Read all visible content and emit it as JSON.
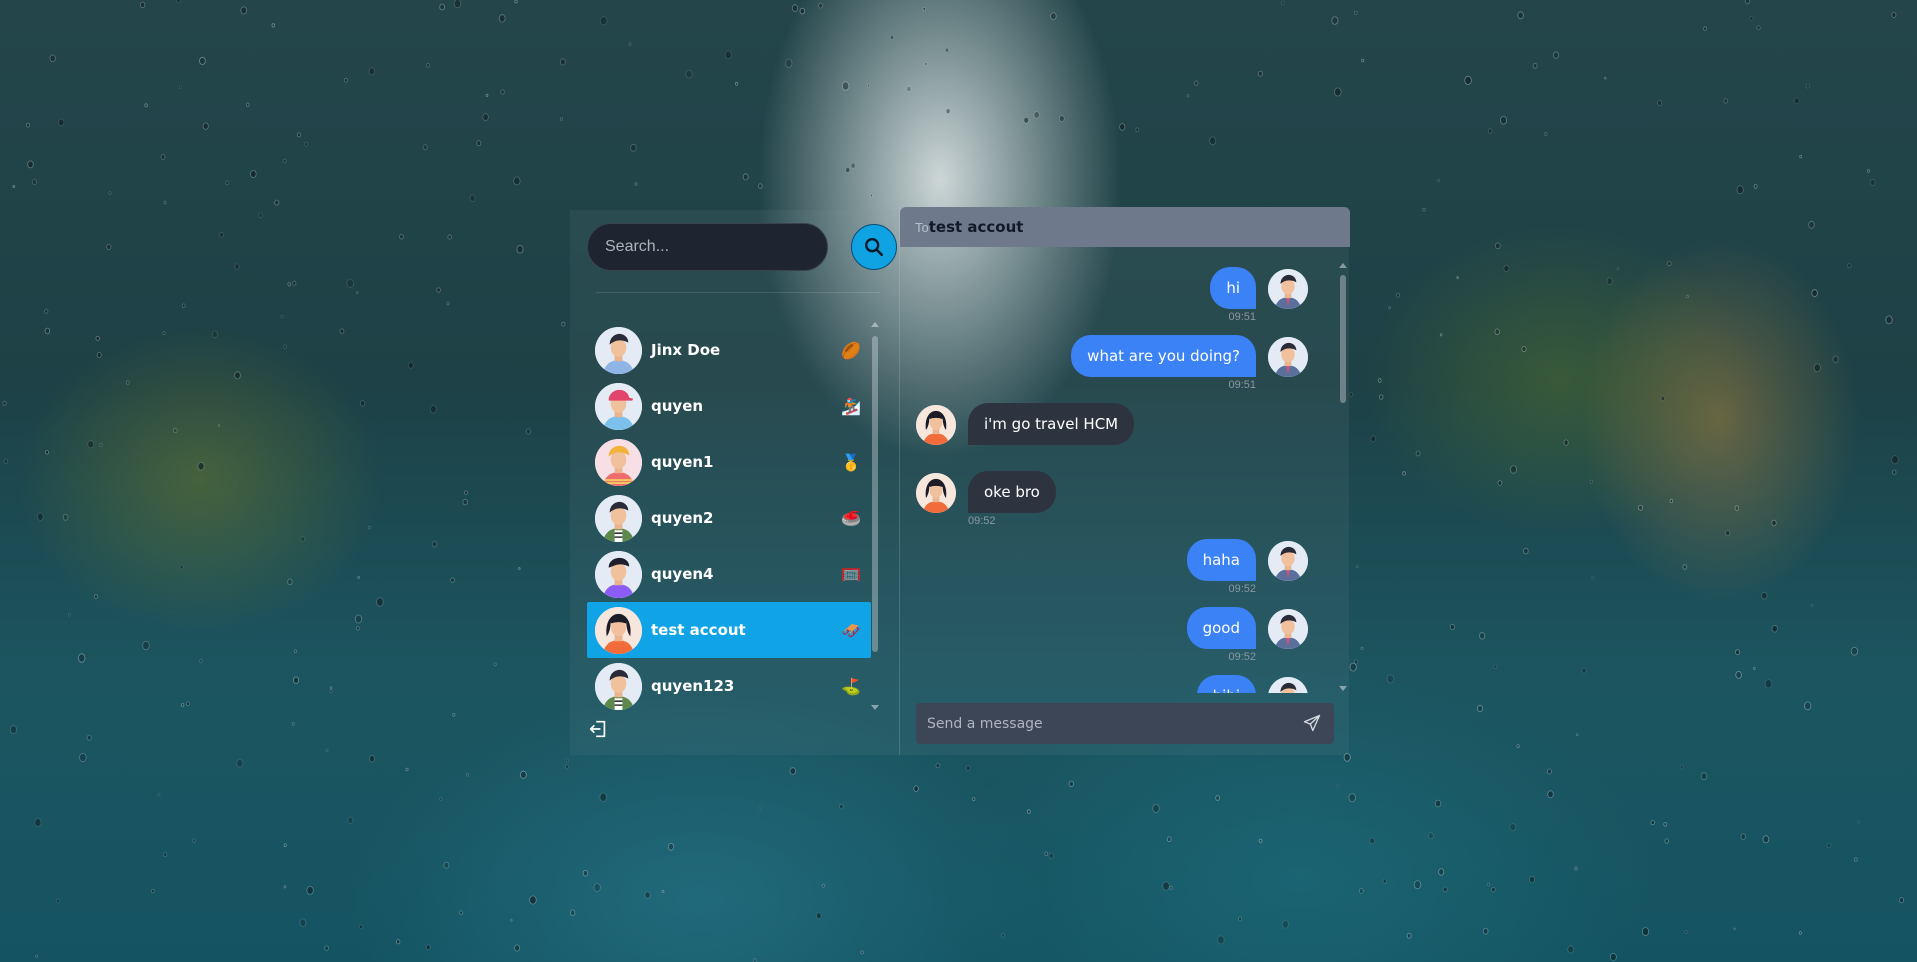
{
  "search": {
    "placeholder": "Search..."
  },
  "contacts": [
    {
      "name": "Jinx Doe",
      "emoji": "🏉"
    },
    {
      "name": "quyen",
      "emoji": "🏂"
    },
    {
      "name": "quyen1",
      "emoji": "🥇"
    },
    {
      "name": "quyen2",
      "emoji": "🥌"
    },
    {
      "name": "quyen4",
      "emoji": "🥅"
    },
    {
      "name": "test accout",
      "emoji": "🛷"
    },
    {
      "name": "quyen123",
      "emoji": "⛳"
    }
  ],
  "chat": {
    "to_label": "To",
    "to_name": "test accout",
    "composer_placeholder": "Send a message",
    "messages": [
      {
        "text": "hi",
        "time": "09:51"
      },
      {
        "text": "what are you doing?",
        "time": "09:51"
      },
      {
        "text": "i'm go travel HCM",
        "time": ""
      },
      {
        "text": "oke bro",
        "time": "09:52"
      },
      {
        "text": "haha",
        "time": "09:52"
      },
      {
        "text": "good",
        "time": "09:52"
      },
      {
        "text": "hihi",
        "time": ""
      }
    ]
  },
  "colors": {
    "accent": "#10a4e6",
    "my_bubble": "#3b82f6",
    "their_bubble": "#2d3440"
  }
}
